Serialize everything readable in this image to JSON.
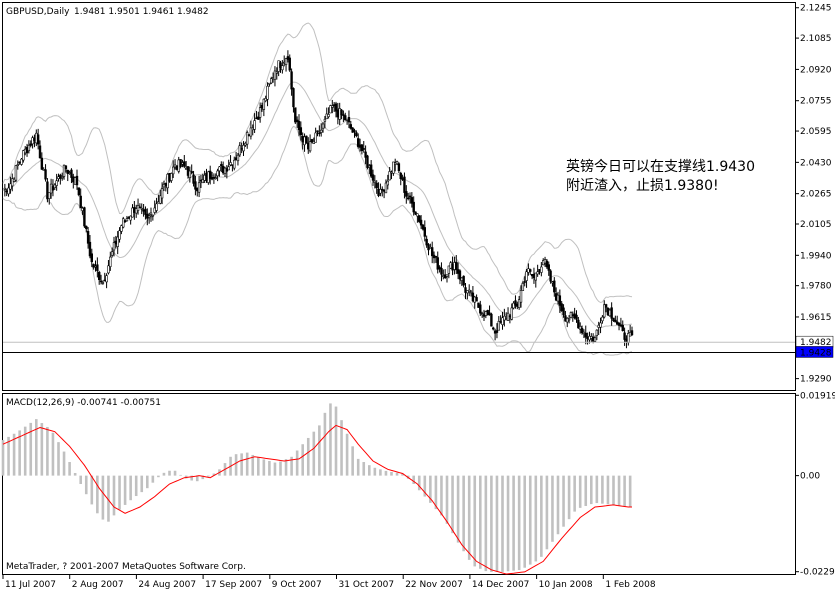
{
  "header": {
    "symbol": "GBPUSD,Daily",
    "ohlc": "1.9481 1.9501 1.9461 1.9482"
  },
  "annotation": {
    "line1": "英镑今日可以在支撑线1.9430",
    "line2": "附近渣入，止损1.9380!"
  },
  "price_tags": {
    "bid": "1.9482",
    "support": "1.9428"
  },
  "colors": {
    "candle": "#000000",
    "bands": "#c0c0c0",
    "macd_hist": "#c0c0c0",
    "signal": "#ff0000",
    "support_tag": "#0000ff",
    "bid_line": "#c0c0c0",
    "background": "#ffffff"
  },
  "macd": {
    "label": "MACD(12,26,9) -0.00741 -0.00751",
    "copyright": "MetaTrader, ? 2001-2007 MetaQuotes Software Corp."
  },
  "chart_data": {
    "type": "candlestick",
    "price_axis": {
      "ticks": [
        "2.1245",
        "2.1085",
        "2.0920",
        "2.0755",
        "2.0595",
        "2.0430",
        "2.0265",
        "2.0105",
        "1.9940",
        "1.9780",
        "1.9615",
        "1.9290"
      ],
      "ylim": [
        1.923,
        2.127
      ]
    },
    "macd_axis": {
      "ticks": [
        "0.01919",
        "0.00",
        "-0.02295"
      ],
      "ylim": [
        -0.0235,
        0.0195
      ]
    },
    "x_labels": [
      "11 Jul 2007",
      "2 Aug 2007",
      "24 Aug 2007",
      "17 Sep 2007",
      "9 Oct 2007",
      "31 Oct 2007",
      "22 Nov 2007",
      "14 Dec 2007",
      "10 Jan 2008",
      "1 Feb 2008"
    ],
    "close_path": [
      [
        0,
        2.028
      ],
      [
        4,
        2.032
      ],
      [
        10,
        2.046
      ],
      [
        18,
        2.058
      ],
      [
        24,
        2.026
      ],
      [
        34,
        2.04
      ],
      [
        40,
        2.032
      ],
      [
        48,
        1.99
      ],
      [
        54,
        1.98
      ],
      [
        64,
        2.01
      ],
      [
        72,
        2.02
      ],
      [
        78,
        2.012
      ],
      [
        85,
        2.026
      ],
      [
        93,
        2.042
      ],
      [
        99,
        2.04
      ],
      [
        105,
        2.03
      ],
      [
        111,
        2.036
      ],
      [
        120,
        2.04
      ],
      [
        126,
        2.046
      ],
      [
        133,
        2.06
      ],
      [
        140,
        2.072
      ],
      [
        147,
        2.092
      ],
      [
        154,
        2.1
      ],
      [
        158,
        2.064
      ],
      [
        165,
        2.05
      ],
      [
        172,
        2.06
      ],
      [
        178,
        2.072
      ],
      [
        185,
        2.066
      ],
      [
        192,
        2.054
      ],
      [
        198,
        2.04
      ],
      [
        204,
        2.026
      ],
      [
        212,
        2.044
      ],
      [
        218,
        2.026
      ],
      [
        224,
        2.016
      ],
      [
        232,
        1.994
      ],
      [
        238,
        1.984
      ],
      [
        244,
        1.99
      ],
      [
        250,
        1.976
      ],
      [
        256,
        1.968
      ],
      [
        262,
        1.962
      ],
      [
        266,
        1.954
      ],
      [
        272,
        1.962
      ],
      [
        278,
        1.968
      ],
      [
        283,
        1.986
      ],
      [
        287,
        1.982
      ],
      [
        292,
        1.992
      ],
      [
        298,
        1.975
      ],
      [
        304,
        1.962
      ],
      [
        310,
        1.96
      ],
      [
        315,
        1.952
      ],
      [
        320,
        1.95
      ],
      [
        325,
        1.968
      ],
      [
        330,
        1.962
      ],
      [
        335,
        1.952
      ],
      [
        340,
        1.95
      ]
    ],
    "macd_hist_path": [
      [
        0,
        0.0085
      ],
      [
        8,
        0.0105
      ],
      [
        18,
        0.0135
      ],
      [
        26,
        0.011
      ],
      [
        34,
        0.005
      ],
      [
        42,
        -0.002
      ],
      [
        50,
        -0.0085
      ],
      [
        56,
        -0.0115
      ],
      [
        62,
        -0.0085
      ],
      [
        70,
        -0.0055
      ],
      [
        78,
        -0.003
      ],
      [
        86,
        0.0005
      ],
      [
        92,
        0.0015
      ],
      [
        98,
        -0.0005
      ],
      [
        104,
        -0.0015
      ],
      [
        110,
        -0.0005
      ],
      [
        116,
        0.001
      ],
      [
        124,
        0.005
      ],
      [
        132,
        0.0055
      ],
      [
        140,
        0.004
      ],
      [
        148,
        0.003
      ],
      [
        156,
        0.0045
      ],
      [
        164,
        0.0085
      ],
      [
        172,
        0.0125
      ],
      [
        176,
        0.0175
      ],
      [
        180,
        0.0165
      ],
      [
        186,
        0.01
      ],
      [
        192,
        0.004
      ],
      [
        200,
        0.002
      ],
      [
        208,
        0.001
      ],
      [
        216,
        0.0005
      ],
      [
        222,
        -0.002
      ],
      [
        230,
        -0.006
      ],
      [
        238,
        -0.01
      ],
      [
        246,
        -0.016
      ],
      [
        254,
        -0.0215
      ],
      [
        262,
        -0.023
      ],
      [
        270,
        -0.023
      ],
      [
        280,
        -0.0225
      ],
      [
        290,
        -0.02
      ],
      [
        300,
        -0.014
      ],
      [
        310,
        -0.008
      ],
      [
        320,
        -0.0065
      ],
      [
        330,
        -0.007
      ],
      [
        338,
        -0.0075
      ]
    ],
    "signal_path": [
      [
        0,
        0.0075
      ],
      [
        10,
        0.0095
      ],
      [
        20,
        0.0115
      ],
      [
        28,
        0.0105
      ],
      [
        36,
        0.007
      ],
      [
        44,
        0.0025
      ],
      [
        52,
        -0.003
      ],
      [
        60,
        -0.0075
      ],
      [
        66,
        -0.009
      ],
      [
        74,
        -0.0075
      ],
      [
        82,
        -0.005
      ],
      [
        90,
        -0.002
      ],
      [
        98,
        -0.0005
      ],
      [
        106,
        0.0
      ],
      [
        112,
        -0.0005
      ],
      [
        120,
        0.0015
      ],
      [
        128,
        0.0035
      ],
      [
        136,
        0.0045
      ],
      [
        144,
        0.004
      ],
      [
        152,
        0.0035
      ],
      [
        160,
        0.004
      ],
      [
        168,
        0.0065
      ],
      [
        176,
        0.0105
      ],
      [
        180,
        0.012
      ],
      [
        186,
        0.011
      ],
      [
        192,
        0.0075
      ],
      [
        200,
        0.0035
      ],
      [
        208,
        0.0015
      ],
      [
        216,
        0.0005
      ],
      [
        224,
        -0.002
      ],
      [
        232,
        -0.006
      ],
      [
        240,
        -0.011
      ],
      [
        248,
        -0.0165
      ],
      [
        256,
        -0.0205
      ],
      [
        264,
        -0.0225
      ],
      [
        272,
        -0.0235
      ],
      [
        282,
        -0.023
      ],
      [
        292,
        -0.0205
      ],
      [
        302,
        -0.015
      ],
      [
        312,
        -0.01
      ],
      [
        320,
        -0.0075
      ],
      [
        330,
        -0.007
      ],
      [
        338,
        -0.0075
      ]
    ],
    "support_level": 1.9428,
    "bid_level": 1.9482
  }
}
